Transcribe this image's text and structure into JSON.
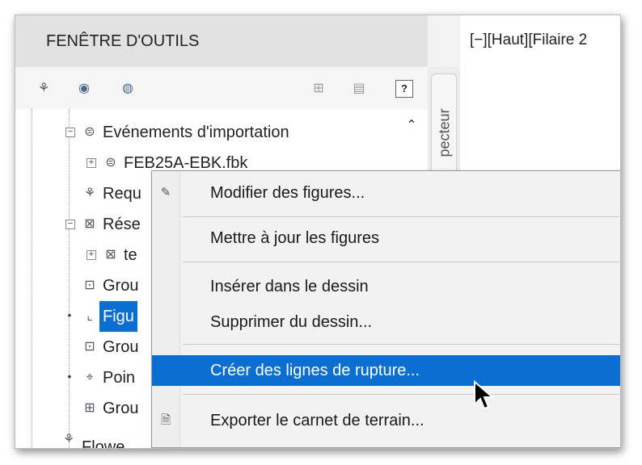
{
  "palette": {
    "title": "FENÊTRE D'OUTILS",
    "toolbar_icons": [
      "survey-tree-icon",
      "zoom-extents-icon",
      "zoom-icon",
      "layout-icon",
      "panel-icon",
      "help-icon"
    ],
    "help_label": "?"
  },
  "side_tab": {
    "label": "pecteur"
  },
  "viewport": {
    "label": "[−][Haut][Filaire 2"
  },
  "tree": {
    "rows": [
      {
        "label": "Evénements d'importation",
        "expander": "−",
        "icon": "import-event-icon"
      },
      {
        "label": "FEB25A-EBK.fbk",
        "expander": "+",
        "icon": "import-event-icon"
      },
      {
        "label": "Requ",
        "expander": "",
        "icon": "query-icon"
      },
      {
        "label": "Rése",
        "expander": "−",
        "icon": "network-icon"
      },
      {
        "label": "te",
        "expander": "+",
        "icon": "network-icon"
      },
      {
        "label": "Grou",
        "expander": "",
        "icon": "group-icon"
      },
      {
        "label": "Figu",
        "expander": "•",
        "icon": "figure-icon",
        "selected": true
      },
      {
        "label": "Grou",
        "expander": "",
        "icon": "figure-group-icon"
      },
      {
        "label": "Poin",
        "expander": "•",
        "icon": "point-icon"
      },
      {
        "label": "Grou",
        "expander": "",
        "icon": "point-group-icon"
      },
      {
        "label": "Flowe",
        "expander": "",
        "icon": "survey-tree-icon"
      }
    ]
  },
  "context_menu": {
    "items": [
      {
        "label": "Modifier des figures...",
        "icon": "edit-figures-icon"
      },
      {
        "label": "Mettre à jour les figures",
        "icon": ""
      },
      {
        "label": "Insérer dans le dessin",
        "icon": ""
      },
      {
        "label": "Supprimer du dessin...",
        "icon": ""
      },
      {
        "label": "Créer des lignes de rupture...",
        "icon": "",
        "highlighted": true
      },
      {
        "label": "Exporter le carnet de terrain...",
        "icon": "export-fieldbook-icon"
      }
    ],
    "highlight_color": "#0a6fd1"
  }
}
